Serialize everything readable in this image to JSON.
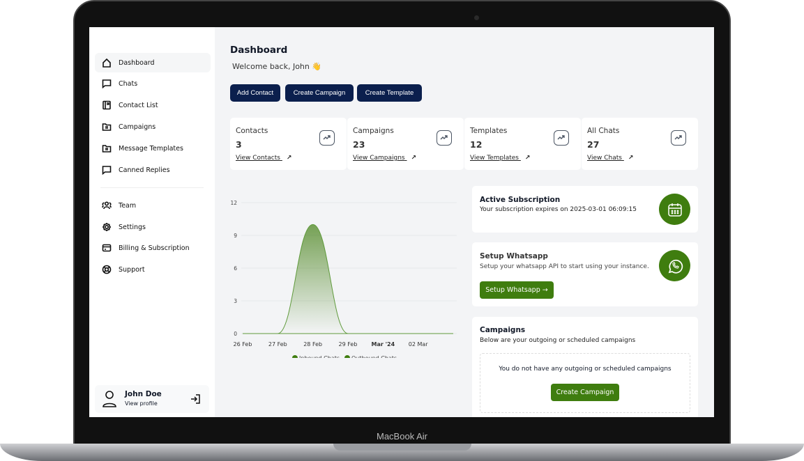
{
  "device": {
    "label": "MacBook Air"
  },
  "sidebar": {
    "items": [
      {
        "label": "Dashboard",
        "icon": "home-icon"
      },
      {
        "label": "Chats",
        "icon": "chat-icon"
      },
      {
        "label": "Contact List",
        "icon": "contact-book-icon"
      },
      {
        "label": "Campaigns",
        "icon": "folder-icon"
      },
      {
        "label": "Message Templates",
        "icon": "folder-icon"
      },
      {
        "label": "Canned Replies",
        "icon": "chat-icon"
      },
      {
        "label": "Team",
        "icon": "users-icon"
      },
      {
        "label": "Settings",
        "icon": "gear-icon"
      },
      {
        "label": "Billing & Subscription",
        "icon": "credit-card-icon"
      },
      {
        "label": "Support",
        "icon": "lifebuoy-icon"
      }
    ],
    "profile": {
      "name": "John Doe",
      "link": "View profile"
    }
  },
  "header": {
    "title": "Dashboard",
    "welcome": "Welcome back, John 👋"
  },
  "actions": [
    "Add Contact",
    "Create Campaign",
    "Create Template"
  ],
  "stats": [
    {
      "title": "Contacts",
      "value": "3",
      "link": "View Contacts"
    },
    {
      "title": "Campaigns",
      "value": "23",
      "link": "View Campaigns"
    },
    {
      "title": "Templates",
      "value": "12",
      "link": "View Templates"
    },
    {
      "title": "All Chats",
      "value": "27",
      "link": "View Chats"
    }
  ],
  "subscription": {
    "title": "Active Subscription",
    "text": "Your subscription expires on 2025-03-01 06:09:15"
  },
  "whatsapp": {
    "title": "Setup Whatsapp",
    "text": "Setup your whatsapp API to start using your instance.",
    "button": "Setup Whatsapp →"
  },
  "campaigns": {
    "title": "Campaigns",
    "subtitle": "Below are your outgoing or scheduled campaigns",
    "empty": "You do not have any outgoing or scheduled campaigns",
    "button": "Create Campaign"
  },
  "colors": {
    "accent": "#3f7d0f",
    "navy": "#0b1f4d"
  },
  "chart_data": {
    "type": "area",
    "categories": [
      "26 Feb",
      "27 Feb",
      "28 Feb",
      "29 Feb",
      "Mar '24",
      "02 Mar",
      ""
    ],
    "yticks": [
      "0",
      "3",
      "6",
      "9",
      "12"
    ],
    "ylim": [
      0,
      12
    ],
    "series": [
      {
        "name": "Inbound Chats",
        "values": [
          0,
          0,
          10,
          0,
          0,
          0,
          0
        ]
      },
      {
        "name": "Outbound Chats",
        "values": [
          0,
          0,
          0,
          0,
          0,
          0,
          0
        ]
      }
    ],
    "legend": "bottom",
    "grid": true
  }
}
